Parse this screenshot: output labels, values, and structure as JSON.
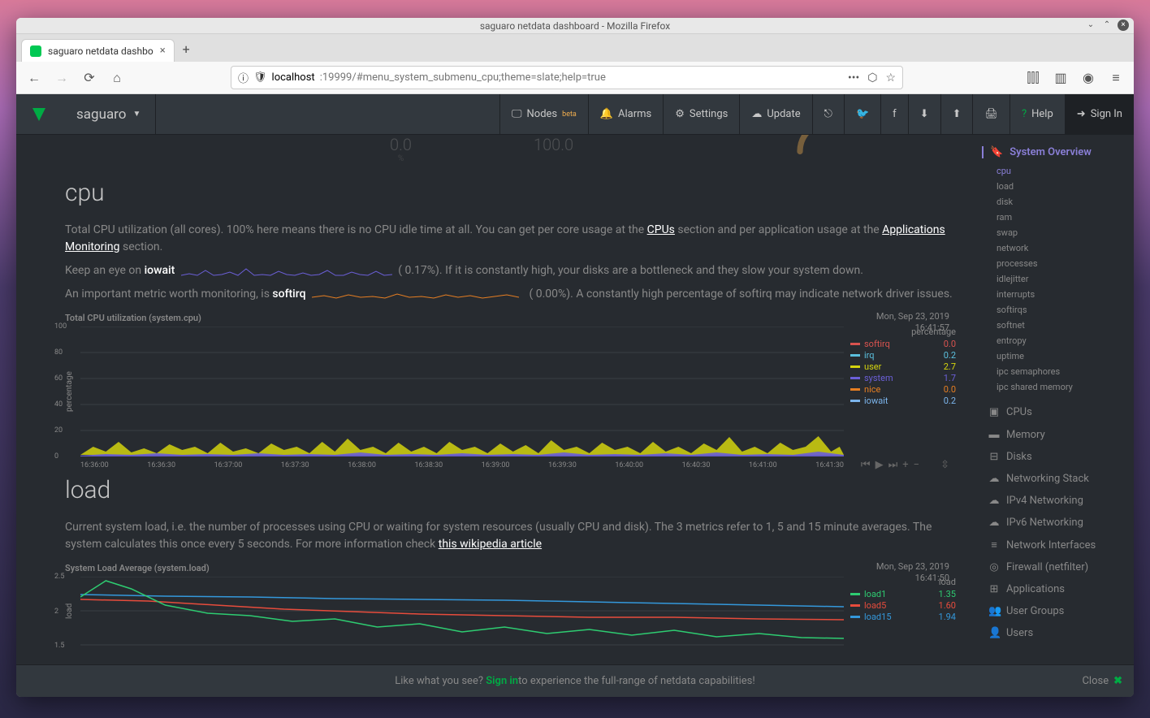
{
  "window": {
    "title": "saguaro netdata dashboard - Mozilla Firefox",
    "tab_title": "saguaro netdata dashbo",
    "url_host": "localhost",
    "url_path": ":19999/#menu_system_submenu_cpu;theme=slate;help=true"
  },
  "topbar": {
    "hostname": "saguaro",
    "nodes": "Nodes",
    "nodes_badge": "beta",
    "alarms": "Alarms",
    "settings": "Settings",
    "update": "Update",
    "help": "Help",
    "signin": "Sign In"
  },
  "gauge": {
    "left_val": "0.0",
    "pct": "%",
    "right_val": "100.0"
  },
  "cpu": {
    "heading": "cpu",
    "desc1a": "Total CPU utilization (all cores). 100% here means there is no CPU idle time at all. You can get per core usage at the ",
    "cpus_link": "CPUs",
    "desc1b": " section and per application usage at the ",
    "apps_link": "Applications Monitoring",
    "desc1c": " section.",
    "desc2a": "Keep an eye on ",
    "iowait_kw": "iowait",
    "iowait_pct": "0.17%",
    "desc2b": "). If it is constantly high, your disks are a bottleneck and they slow your system down.",
    "desc3a": "An important metric worth monitoring, is ",
    "softirq_kw": "softirq",
    "softirq_pct": "0.00%",
    "desc3b": "). A constantly high percentage of softirq may indicate network driver issues.",
    "chart_title": "Total CPU utilization (system.cpu)",
    "ylabel": "percentage",
    "time_date": "Mon, Sep 23, 2019",
    "time_clock": "16:41:57",
    "legend_caption": "percentage"
  },
  "chart_data": {
    "type": "area",
    "yticks": [
      0.0,
      20.0,
      40.0,
      60.0,
      80.0,
      100.0
    ],
    "xticks": [
      "16:36:00",
      "16:36:30",
      "16:37:00",
      "16:37:30",
      "16:38:00",
      "16:38:30",
      "16:39:00",
      "16:39:30",
      "16:40:00",
      "16:40:30",
      "16:41:00",
      "16:41:30"
    ],
    "series": [
      {
        "name": "softirq",
        "color": "#d9534f",
        "value": 0.0
      },
      {
        "name": "irq",
        "color": "#5bc0de",
        "value": 0.2
      },
      {
        "name": "user",
        "color": "#d4d40e",
        "value": 2.7
      },
      {
        "name": "system",
        "color": "#6b5fd7",
        "value": 1.7
      },
      {
        "name": "nice",
        "color": "#e67e22",
        "value": 0.0
      },
      {
        "name": "iowait",
        "color": "#7cb5ec",
        "value": 0.2
      }
    ],
    "ylim": [
      0,
      100
    ]
  },
  "load": {
    "heading": "load",
    "desc_a": "Current system load, i.e. the number of processes using CPU or waiting for system resources (usually CPU and disk). The 3 metrics refer to 1, 5 and 15 minute averages. The system calculates this once every 5 seconds. For more information check ",
    "wiki_link": "this wikipedia article",
    "chart_title": "System Load Average (system.load)",
    "ylabel": "load",
    "time_date": "Mon, Sep 23, 2019",
    "time_clock": "16:41:50",
    "legend_caption": "load"
  },
  "load_chart": {
    "type": "line",
    "yticks": [
      1.5,
      2.0,
      2.5
    ],
    "series": [
      {
        "name": "load1",
        "color": "#2ecc71",
        "value": 1.35
      },
      {
        "name": "load5",
        "color": "#e74c3c",
        "value": 1.6
      },
      {
        "name": "load15",
        "color": "#3498db",
        "value": 1.94
      }
    ]
  },
  "sidebar": {
    "overview": "System Overview",
    "subs": [
      "cpu",
      "load",
      "disk",
      "ram",
      "swap",
      "network",
      "processes",
      "idlejitter",
      "interrupts",
      "softirqs",
      "softnet",
      "entropy",
      "uptime",
      "ipc semaphores",
      "ipc shared memory"
    ],
    "cats": [
      {
        "icon": "▣",
        "label": "CPUs"
      },
      {
        "icon": "▬",
        "label": "Memory"
      },
      {
        "icon": "⊟",
        "label": "Disks"
      },
      {
        "icon": "☁",
        "label": "Networking Stack"
      },
      {
        "icon": "☁",
        "label": "IPv4 Networking"
      },
      {
        "icon": "☁",
        "label": "IPv6 Networking"
      },
      {
        "icon": "≡",
        "label": "Network Interfaces"
      },
      {
        "icon": "◎",
        "label": "Firewall (netfilter)"
      },
      {
        "icon": "⊞",
        "label": "Applications"
      },
      {
        "icon": "👥",
        "label": "User Groups"
      },
      {
        "icon": "👤",
        "label": "Users"
      }
    ]
  },
  "bottombar": {
    "prefix": "Like what you see? ",
    "signin": "Sign in",
    "suffix": " to experience the full-range of netdata capabilities!",
    "close": "Close"
  }
}
